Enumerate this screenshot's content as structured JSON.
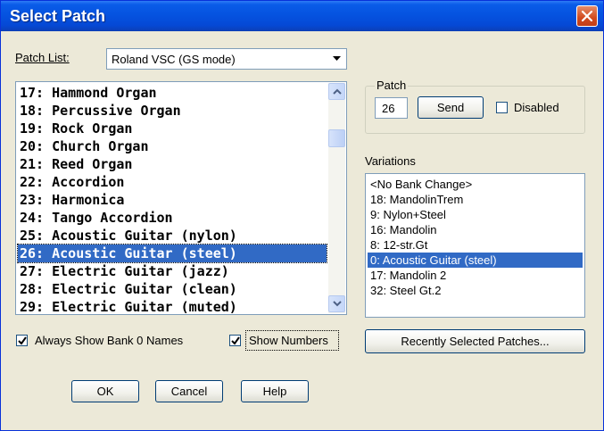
{
  "window": {
    "title": "Select Patch"
  },
  "patch_list": {
    "label": "Patch List:",
    "selected": "Roland VSC (GS mode)",
    "items": [
      "17: Hammond Organ",
      "18: Percussive Organ",
      "19: Rock Organ",
      "20: Church Organ",
      "21: Reed Organ",
      "22: Accordion",
      "23: Harmonica",
      "24: Tango Accordion",
      "25: Acoustic Guitar (nylon)",
      "26: Acoustic Guitar (steel)",
      "27: Electric Guitar (jazz)",
      "28: Electric Guitar (clean)",
      "29: Electric Guitar (muted)"
    ],
    "selected_index": 9
  },
  "patch_group": {
    "title": "Patch",
    "value": "26",
    "send_label": "Send",
    "disabled_label": "Disabled",
    "disabled_checked": false
  },
  "variations": {
    "label": "Variations",
    "items": [
      "<No Bank Change>",
      "18: MandolinTrem",
      "9: Nylon+Steel",
      "16: Mandolin",
      "8: 12-str.Gt",
      "0: Acoustic Guitar (steel)",
      "17: Mandolin 2",
      "32: Steel Gt.2"
    ],
    "selected_index": 5
  },
  "options": {
    "always_show_label": "Always Show Bank 0 Names",
    "always_show_checked": true,
    "show_numbers_label": "Show Numbers",
    "show_numbers_checked": true
  },
  "buttons": {
    "recent": "Recently Selected Patches...",
    "ok": "OK",
    "cancel": "Cancel",
    "help": "Help"
  },
  "colors": {
    "title_bar": "#0553e0",
    "selection": "#316ac5",
    "close_button": "#d14a1e"
  }
}
